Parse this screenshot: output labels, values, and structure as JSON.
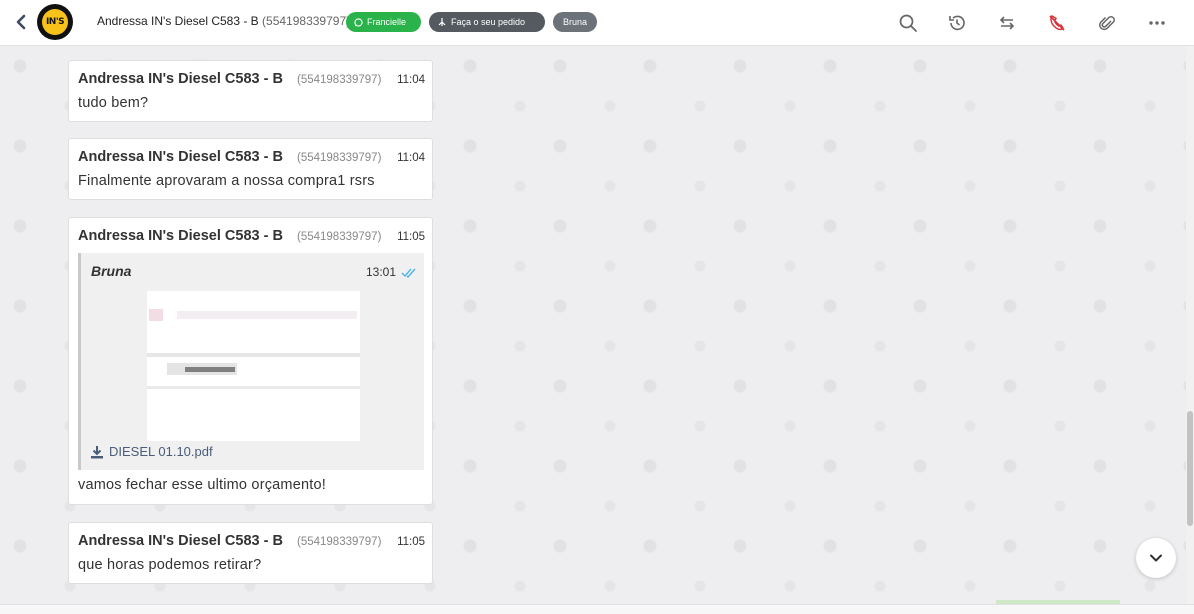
{
  "header": {
    "contact_name": "Andressa IN's Diesel C583 - B",
    "contact_phone": " (554198339797)",
    "avatar_text": "IN'S",
    "tags": {
      "agent": "Francielle",
      "queue": "Faça o seu pedido",
      "user": "Bruna"
    },
    "icons": [
      "search-icon",
      "history-icon",
      "transfer-icon",
      "end-call-icon",
      "attach-icon",
      "more-icon"
    ]
  },
  "messages": [
    {
      "sender": "Andressa IN's Diesel C583 - B",
      "phone": "(554198339797)",
      "time": "11:04",
      "text": "tudo bem?"
    },
    {
      "sender": "Andressa IN's Diesel C583 - B",
      "phone": "(554198339797)",
      "time": "11:04",
      "text": "Finalmente aprovaram a nossa compra1 rsrs"
    },
    {
      "sender": "Andressa IN's Diesel C583 - B",
      "phone": "(554198339797)",
      "time": "11:05",
      "quote": {
        "author": "Bruna",
        "time": "13:01",
        "file": "DIESEL 01.10.pdf"
      },
      "text": "vamos fechar esse ultimo orçamento!"
    },
    {
      "sender": "Andressa IN's Diesel C583 - B",
      "phone": "(554198339797)",
      "time": "11:05",
      "text": "que horas podemos retirar?"
    }
  ],
  "colors": {
    "green_tag": "#2bb34b",
    "dark_tag": "#555a60",
    "gray_tag": "#6c7279",
    "end_call": "#d9343a",
    "read_check": "#4fb3e8",
    "avatar_yellow": "#f7c31a"
  }
}
